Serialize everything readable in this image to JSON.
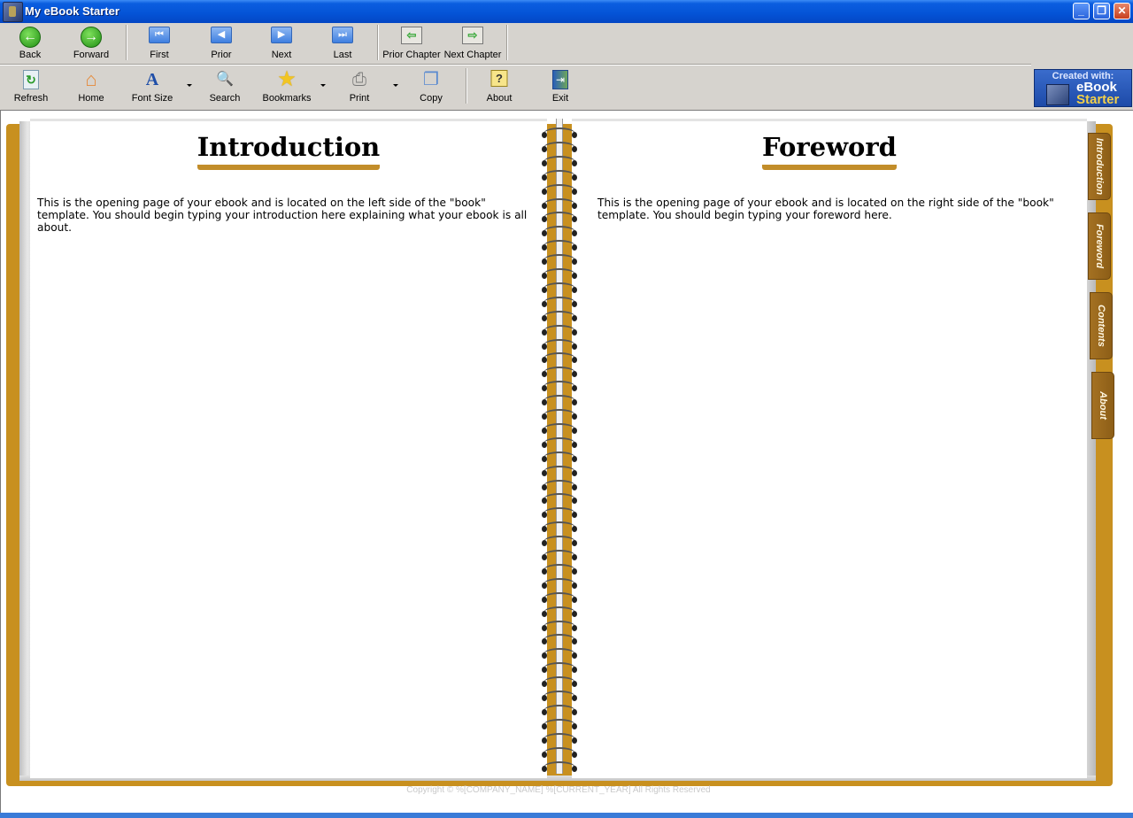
{
  "window": {
    "title": "My eBook Starter",
    "controls": {
      "minimize": "_",
      "maximize": "❐",
      "close": "✕"
    }
  },
  "toolbar_row1": [
    {
      "id": "back",
      "label": "Back",
      "icon": "back-arrow-icon",
      "glyph": "←"
    },
    {
      "id": "forward",
      "label": "Forward",
      "icon": "forward-arrow-icon",
      "glyph": "→"
    },
    {
      "id": "first",
      "label": "First",
      "icon": "first-page-icon",
      "glyph": "⏮"
    },
    {
      "id": "prior",
      "label": "Prior",
      "icon": "prior-page-icon",
      "glyph": "◀"
    },
    {
      "id": "next",
      "label": "Next",
      "icon": "next-page-icon",
      "glyph": "▶"
    },
    {
      "id": "last",
      "label": "Last",
      "icon": "last-page-icon",
      "glyph": "⏭"
    },
    {
      "id": "prior-chapter",
      "label": "Prior Chapter",
      "icon": "prior-chapter-icon",
      "glyph": "⇦"
    },
    {
      "id": "next-chapter",
      "label": "Next Chapter",
      "icon": "next-chapter-icon",
      "glyph": "⇨"
    }
  ],
  "toolbar_row2": [
    {
      "id": "refresh",
      "label": "Refresh",
      "icon": "refresh-icon",
      "glyph": "↻"
    },
    {
      "id": "home",
      "label": "Home",
      "icon": "home-icon",
      "glyph": "⌂"
    },
    {
      "id": "font-size",
      "label": "Font Size",
      "icon": "font-size-icon",
      "glyph": "A"
    },
    {
      "id": "search",
      "label": "Search",
      "icon": "search-icon",
      "glyph": "🔍"
    },
    {
      "id": "bookmarks",
      "label": "Bookmarks",
      "icon": "bookmark-star-icon",
      "glyph": "★"
    },
    {
      "id": "print",
      "label": "Print",
      "icon": "printer-icon",
      "glyph": "⎙"
    },
    {
      "id": "copy",
      "label": "Copy",
      "icon": "copy-icon",
      "glyph": "❐"
    },
    {
      "id": "about",
      "label": "About",
      "icon": "help-icon",
      "glyph": "?"
    },
    {
      "id": "exit",
      "label": "Exit",
      "icon": "exit-door-icon",
      "glyph": "⇥"
    }
  ],
  "badge": {
    "line1": "Created with:",
    "line2": "eBook",
    "line3": "Starter"
  },
  "book": {
    "left_page": {
      "heading": "Introduction",
      "body": "This is the opening page of your ebook and is located on the left side of the \"book\" template. You should begin typing your introduction here explaining what your ebook is all about."
    },
    "right_page": {
      "heading": "Foreword",
      "body": "This is the opening page of your ebook and is located on the right side of the \"book\" template. You should begin typing your foreword here."
    },
    "tabs": [
      "Introduction",
      "Foreword",
      "Contents",
      "About"
    ]
  },
  "footer": {
    "copyright": "Copyright © %[COMPANY_NAME] %[CURRENT_YEAR] All Rights Reserved"
  },
  "colors": {
    "accent_gold": "#c8901f",
    "tab_brown": "#8d5e17",
    "titlebar_blue": "#0453d6",
    "toolbar_gray": "#d6d3ce"
  }
}
